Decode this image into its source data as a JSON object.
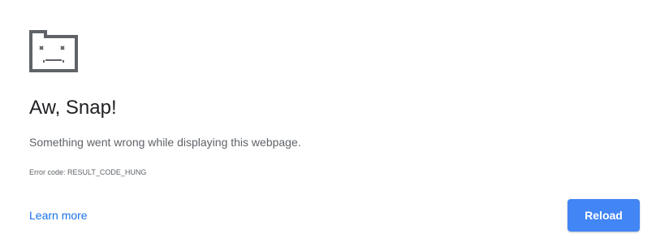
{
  "error_page": {
    "icon": "sad-tab-icon",
    "heading": "Aw, Snap!",
    "message": "Something went wrong while displaying this webpage.",
    "error_code": "Error code: RESULT_CODE_HUNG",
    "learn_more_label": "Learn more",
    "reload_label": "Reload"
  },
  "colors": {
    "accent": "#4285f4",
    "link": "#1a73e8",
    "heading": "#202124",
    "body_text": "#5f6368",
    "icon": "#5f6368"
  }
}
